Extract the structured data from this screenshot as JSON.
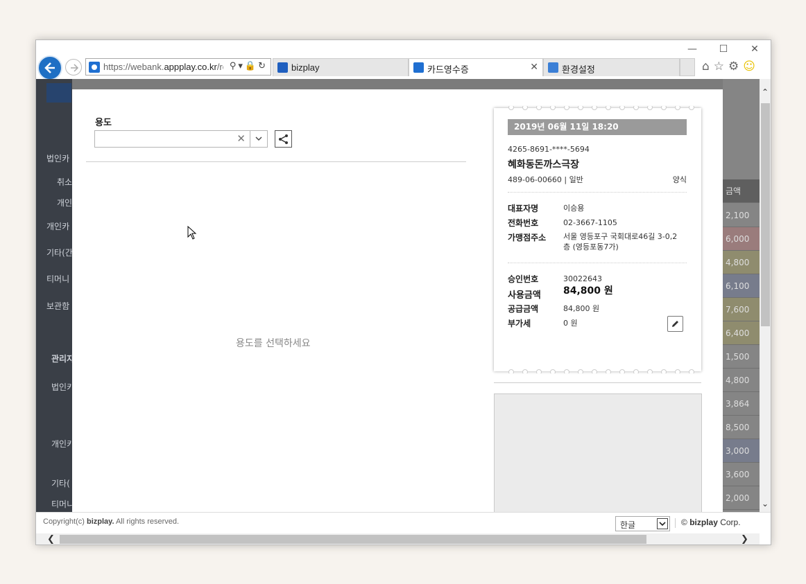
{
  "browser": {
    "url_prefix": "https://webank.",
    "url_domain": "appplay.co.kr",
    "url_suffix": "/rc",
    "tabs": [
      {
        "label": "bizplay",
        "active": false
      },
      {
        "label": "카드영수증",
        "active": true
      },
      {
        "label": "환경설정",
        "active": false
      }
    ],
    "accent": "#1e6fc4"
  },
  "modal": {
    "use_label": "용도",
    "use_placeholder": "",
    "empty_message": "용도를 선택하세요"
  },
  "receipt": {
    "datetime": "2019년 06월 11일 18:20",
    "card_number": "4265-8691-****-5694",
    "merchant": "혜화동돈까스극장",
    "biz_no": "489-06-00660 | 일반",
    "category": "양식",
    "rows_info": [
      {
        "key": "대표자명",
        "value": "이승용"
      },
      {
        "key": "전화번호",
        "value": "02-3667-1105"
      },
      {
        "key": "가맹점주소",
        "value": "서울 영등포구 국회대로46길 3-0,2층 (영등포동7가)"
      }
    ],
    "approval_no_label": "승인번호",
    "approval_no": "30022643",
    "amount_label": "사용금액",
    "amount": "84,800 원",
    "supply_label": "공급금액",
    "supply": "84,800 원",
    "vat_label": "부가세",
    "vat": "0 원"
  },
  "background": {
    "sidebar_items": [
      "법인카",
      "취소",
      "개인",
      "개인카",
      "기타(간",
      "티머니",
      "보관함",
      "관리자",
      "법인카",
      "개인카",
      "기타(",
      "티머니"
    ],
    "amounts": [
      "금액",
      "2,100",
      "6,000",
      "4,800",
      "6,100",
      "7,600",
      "6,400",
      "1,500",
      "4,800",
      "3,864",
      "8,500",
      "3,000",
      "3,600",
      "2,000"
    ]
  },
  "footer": {
    "copyright_prefix": "Copyright(c)",
    "copyright_brand": "bizplay.",
    "copyright_suffix": "All rights reserved.",
    "language": "한글",
    "corp_symbol": "©",
    "corp_brand": "bizplay",
    "corp_suffix": "Corp."
  }
}
